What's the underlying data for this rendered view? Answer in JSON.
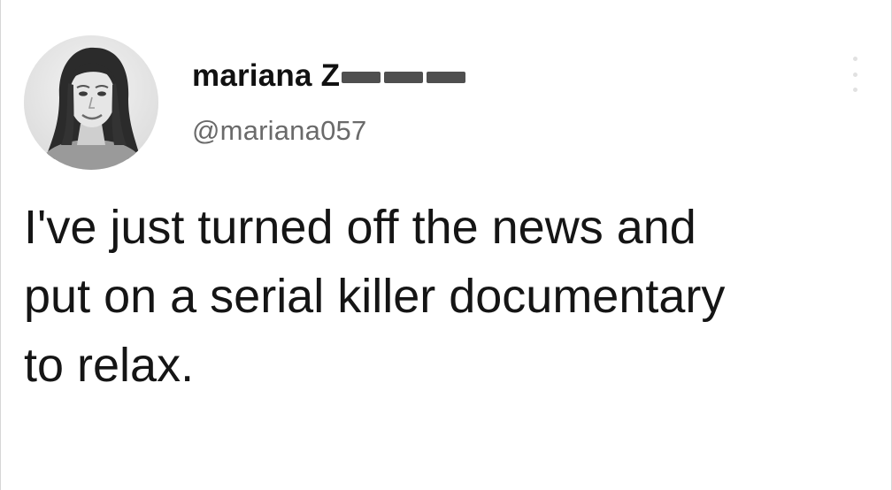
{
  "tweet": {
    "display_name": "mariana Z",
    "display_name_redacted": true,
    "handle": "@mariana057",
    "text_lines": [
      "I've just turned off the news and",
      "put on a serial killer documentary",
      "to relax."
    ],
    "avatar_icon": "profile-photo",
    "menu_icon": "more-options-icon"
  },
  "colors": {
    "background": "#ffffff",
    "text": "#151515",
    "handle": "#6a6a6a",
    "redaction": "#4f4f4f"
  }
}
